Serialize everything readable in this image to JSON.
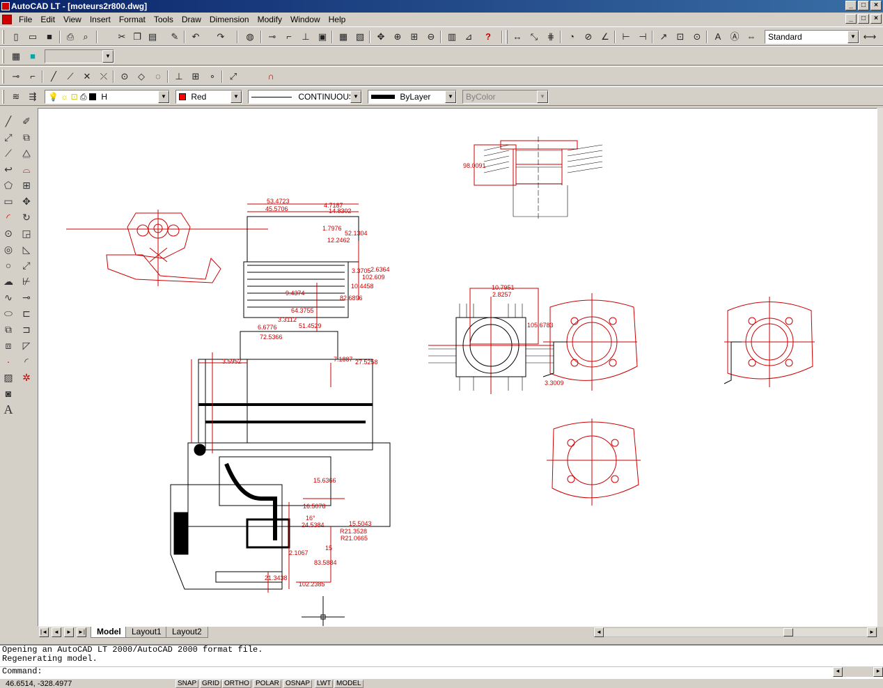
{
  "window": {
    "title": "AutoCAD LT - [moteurs2r800.dwg]",
    "controls": [
      "_",
      "□",
      "×"
    ]
  },
  "menu": {
    "items": [
      "File",
      "Edit",
      "View",
      "Insert",
      "Format",
      "Tools",
      "Draw",
      "Dimension",
      "Modify",
      "Window",
      "Help"
    ],
    "doc_controls": [
      "_",
      "□",
      "×"
    ]
  },
  "standard_toolbar": {
    "icons": [
      "new-icon",
      "open-icon",
      "save-icon",
      "print-icon",
      "print-preview-icon",
      "cut-icon",
      "copy-icon",
      "paste-icon",
      "match-properties-icon",
      "undo-icon",
      "redo-icon",
      "browse-web-icon",
      "snap-from-icon",
      "snap-endpoint-icon",
      "ucs-icon",
      "named-views-icon",
      "aerial-view-icon",
      "pan-realtime-icon",
      "zoom-realtime-icon",
      "zoom-window-icon",
      "zoom-previous-icon",
      "properties-icon",
      "design-center-icon",
      "help-icon"
    ],
    "dim_icons": [
      "linear-dim-icon",
      "aligned-dim-icon",
      "ordinate-dim-icon",
      "radius-dim-icon",
      "diameter-dim-icon",
      "angular-dim-icon",
      "baseline-dim-icon",
      "continue-dim-icon",
      "leader-icon",
      "tolerance-icon",
      "center-mark-icon",
      "dim-edit-icon",
      "dim-text-edit-icon",
      "dim-update-icon"
    ],
    "dimstyle_value": "Standard"
  },
  "ucs_toolbar": {
    "combo_value": ""
  },
  "snap_toolbar": {
    "icons": [
      "osnap-temp-icon",
      "osnap-from-icon",
      "endpoint-icon",
      "midpoint-icon",
      "intersection-icon",
      "apparent-intersection-icon",
      "center-icon",
      "quadrant-icon",
      "tangent-icon",
      "perpendicular-icon",
      "insertion-icon",
      "node-icon",
      "nearest-icon",
      "osnap-none-icon"
    ]
  },
  "properties_toolbar": {
    "layer_value": "H",
    "color_value": "Red",
    "color_hex": "#ff0000",
    "linetype_value": "CONTINUOUS",
    "lineweight_value": "ByLayer",
    "plotstyle_value": "ByColor"
  },
  "draw_toolbar": {
    "icons": [
      "line-icon",
      "construction-line-icon",
      "polyline-icon",
      "polygon-icon",
      "rectangle-icon",
      "arc-icon",
      "circle-icon",
      "spline-icon",
      "ellipse-icon",
      "insert-block-icon",
      "make-block-icon",
      "point-icon",
      "hatch-icon",
      "region-icon",
      "mtext-icon"
    ]
  },
  "modify_toolbar": {
    "icons": [
      "erase-icon",
      "copy-object-icon",
      "mirror-icon",
      "offset-icon",
      "array-icon",
      "move-icon",
      "rotate-icon",
      "scale-icon",
      "stretch-icon",
      "lengthen-icon",
      "trim-icon",
      "extend-icon",
      "break-icon",
      "chamfer-icon",
      "fillet-icon",
      "explode-icon"
    ]
  },
  "drawing": {
    "dimensions": [
      "53.4723",
      "45.5706",
      "4.7187",
      "14.8302",
      "1.7976",
      "52.1304",
      "12.2462",
      "3.3705",
      "2.6364",
      "102.609",
      "10.4458",
      "9.4374",
      "82.6896",
      "64.3755",
      "3.3112",
      "6.6776",
      "51.4529",
      "72.5366",
      "3.5952",
      "7.1887",
      "27.5258",
      "98.0091",
      "10.7951",
      "2.8257",
      "105.6783",
      "16.5078",
      "15.5043",
      "R21.3528",
      "R21.0665",
      "2.1067",
      "83.5884",
      "21.3438",
      "102.2385",
      "3.3009",
      "16°",
      "15",
      "24.5384",
      "15.6366"
    ],
    "accent_color": "#cc0000"
  },
  "layout_tabs": {
    "nav": [
      "|◄",
      "◄",
      "►",
      "►|"
    ],
    "tabs": [
      "Model",
      "Layout1",
      "Layout2"
    ],
    "active": "Model"
  },
  "command": {
    "history": [
      "Opening an AutoCAD LT 2000/AutoCAD 2000 format file.",
      "Regenerating model."
    ],
    "prompt": "Command:"
  },
  "status": {
    "coordinates": "46.6514, -328.4977",
    "toggles": [
      "SNAP",
      "GRID",
      "ORTHO",
      "POLAR",
      "OSNAP",
      "LWT",
      "MODEL"
    ]
  }
}
